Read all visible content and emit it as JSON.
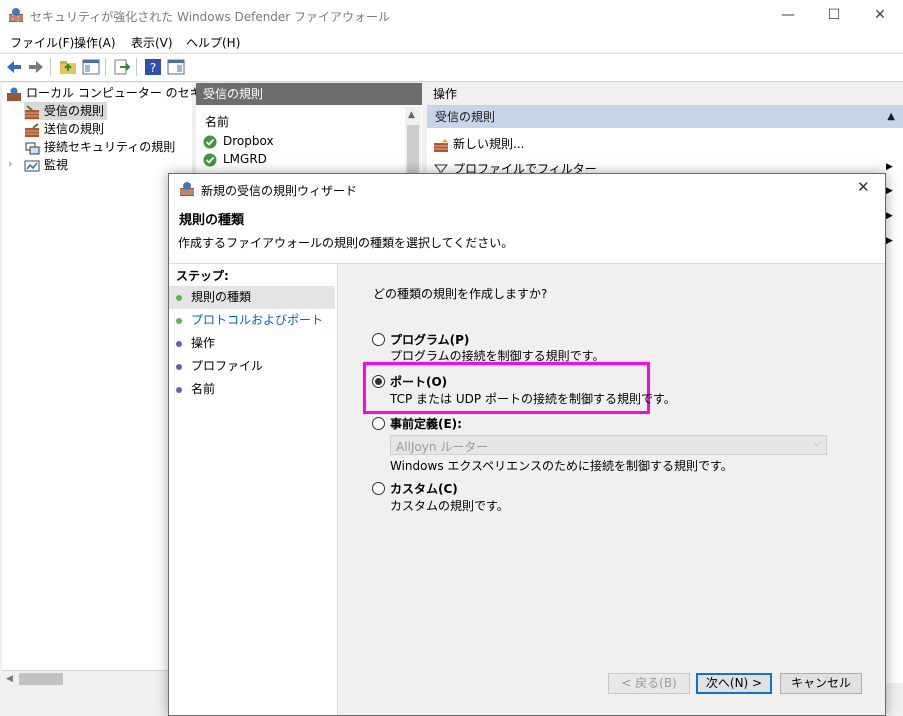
{
  "window": {
    "title": "セキュリティが強化された Windows Defender ファイアウォール",
    "controls": {
      "minimize": "—",
      "maximize": "☐",
      "close": "✕"
    }
  },
  "menu": [
    "ファイル(F)",
    "操作(A)",
    "表示(V)",
    "ヘルプ(H)"
  ],
  "tree": {
    "root": "ローカル コンピューター のセキュリティ",
    "items": [
      "受信の規則",
      "送信の規則",
      "接続セキュリティの規則",
      "監視"
    ]
  },
  "middle": {
    "header": "受信の規則",
    "column": "名前",
    "rows": [
      "Dropbox",
      "LMGRD"
    ]
  },
  "actions": {
    "header": "操作",
    "section": "受信の規則",
    "items": [
      "新しい規則...",
      "プロファイルでフィルター"
    ]
  },
  "dialog": {
    "title": "新規の受信の規則ウィザード",
    "heading": "規則の種類",
    "description": "作成するファイアウォールの規則の種類を選択してください。",
    "steps_label": "ステップ:",
    "steps": [
      "規則の種類",
      "プロトコルおよびポート",
      "操作",
      "プロファイル",
      "名前"
    ],
    "question": "どの種類の規則を作成しますか?",
    "options": [
      {
        "label": "プログラム(P)",
        "desc": "プログラムの接続を制御する規則です。"
      },
      {
        "label": "ポート(O)",
        "desc": "TCP または UDP ポートの接続を制御する規則です。"
      },
      {
        "label": "事前定義(E):",
        "desc": "Windows エクスペリエンスのために接続を制御する規則です。",
        "select": "AllJoyn ルーター"
      },
      {
        "label": "カスタム(C)",
        "desc": "カスタムの規則です。"
      }
    ],
    "buttons": {
      "back": "< 戻る(B)",
      "next": "次へ(N) >",
      "cancel": "キャンセル"
    }
  },
  "colors": {
    "highlight_box": "#ff00ff",
    "link_step": "#0066cc",
    "selected_section": "#c5d6ea"
  }
}
